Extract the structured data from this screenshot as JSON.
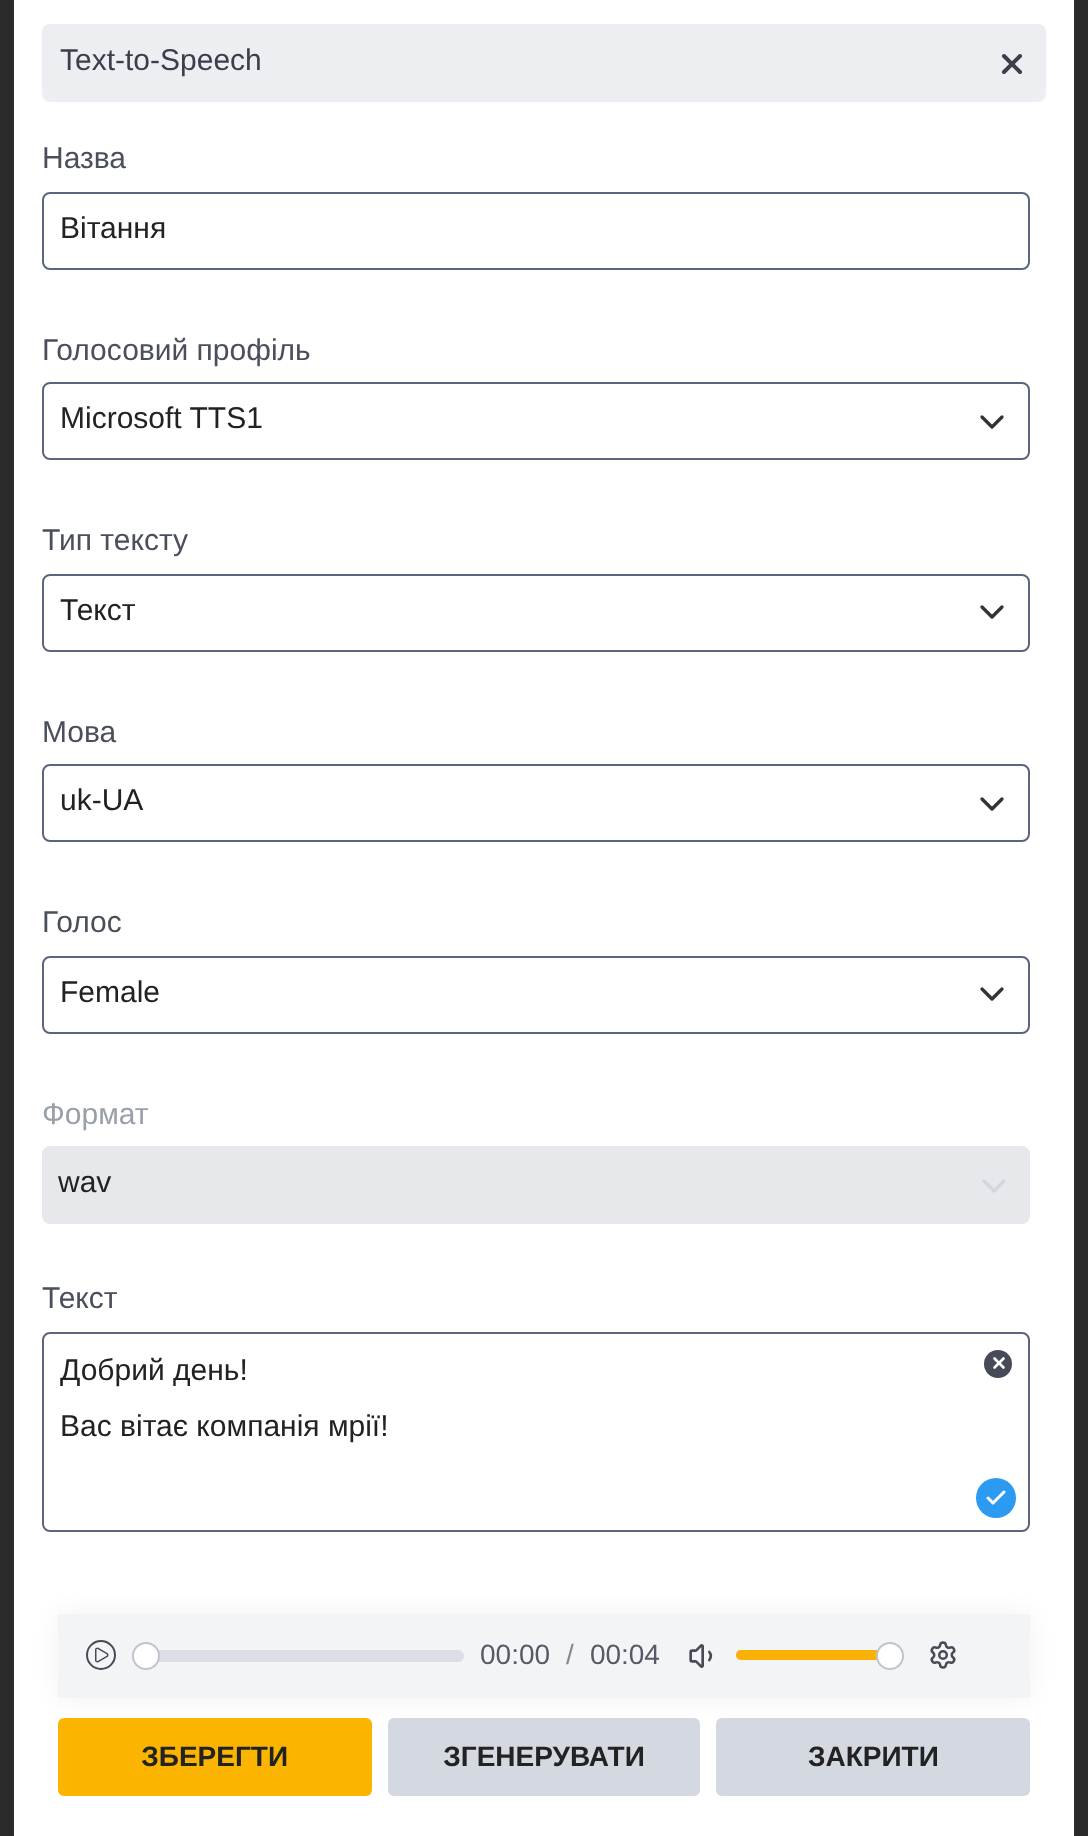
{
  "header": {
    "title": "Text-to-Speech"
  },
  "fields": [
    {
      "kind": "text",
      "label": "Назва",
      "value": "Вітання",
      "disabled": false
    },
    {
      "kind": "select",
      "label": "Голосовий профіль",
      "value": "Microsoft TTS1",
      "disabled": false
    },
    {
      "kind": "select",
      "label": "Тип тексту",
      "value": "Текст",
      "disabled": false
    },
    {
      "kind": "select",
      "label": "Мова",
      "value": "uk-UA",
      "disabled": false
    },
    {
      "kind": "select",
      "label": "Голос",
      "value": "Female",
      "disabled": false
    },
    {
      "kind": "select",
      "label": "Формат",
      "value": "wav",
      "disabled": true
    }
  ],
  "text_field": {
    "label": "Текст",
    "lines": [
      "Добрий день!",
      "Вас вітає компанія мрії!"
    ]
  },
  "player": {
    "position": {
      "level": 0
    },
    "current": "00:00",
    "separator": "/",
    "duration": "00:04",
    "volume": {
      "level": 1
    }
  },
  "buttons": [
    {
      "kind": "primary",
      "label": "ЗБЕРЕГТИ"
    },
    {
      "kind": "secondary",
      "label": "ЗГЕНЕРУВАТИ"
    },
    {
      "kind": "secondary",
      "label": "ЗАКРИТИ"
    }
  ]
}
